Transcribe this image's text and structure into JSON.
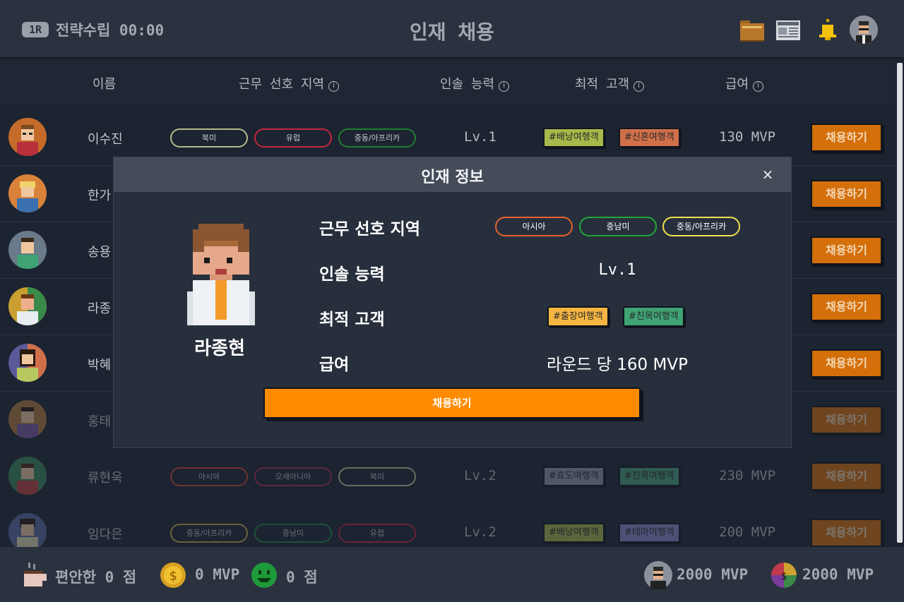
{
  "header": {
    "round_badge": "1R",
    "phase": "전략수립 00:00",
    "title": "인재 채용",
    "icons": [
      "folder-icon",
      "news-icon",
      "bell-icon",
      "user-avatar"
    ]
  },
  "table": {
    "columns": [
      "이름",
      "근무 선호 지역",
      "인솔 능력",
      "최적 고객",
      "급여"
    ],
    "hire_label": "채용하기",
    "rows": [
      {
        "name": "이수진",
        "regions": [
          {
            "label": "북미",
            "color": "#b5b98a"
          },
          {
            "label": "유럽",
            "color": "#c2283c"
          },
          {
            "label": "중동/아프리카",
            "color": "#1e7d33"
          }
        ],
        "level": "Lv.1",
        "customers": [
          {
            "label": "#배낭여행객",
            "color": "#a8b84a"
          },
          {
            "label": "#신혼여행객",
            "color": "#d0704a"
          }
        ],
        "salary": "130 MVP"
      },
      {
        "name": "한가",
        "regions": [],
        "level": "",
        "customers": [],
        "salary": ""
      },
      {
        "name": "송용",
        "regions": [],
        "level": "",
        "customers": [],
        "salary": ""
      },
      {
        "name": "라종",
        "regions": [],
        "level": "",
        "customers": [],
        "salary": ""
      },
      {
        "name": "박혜",
        "regions": [],
        "level": "",
        "customers": [],
        "salary": ""
      },
      {
        "name": "홍태",
        "regions": [],
        "level": "",
        "customers": [],
        "salary": ""
      },
      {
        "name": "류현욱",
        "regions": [
          {
            "label": "아시아",
            "color": "#d0463a"
          },
          {
            "label": "오세아니아",
            "color": "#b02a5a"
          },
          {
            "label": "북미",
            "color": "#c8c89a"
          }
        ],
        "level": "Lv.2",
        "customers": [
          {
            "label": "#효도여행객",
            "color": "#8a96a8"
          },
          {
            "label": "#친목여행객",
            "color": "#4aa07a"
          }
        ],
        "salary": "230 MVP"
      },
      {
        "name": "임다은",
        "regions": [
          {
            "label": "중동/아프리카",
            "color": "#c8b04a"
          },
          {
            "label": "중남미",
            "color": "#1e8a40"
          },
          {
            "label": "유럽",
            "color": "#c2283c"
          }
        ],
        "level": "Lv.2",
        "customers": [
          {
            "label": "#배낭여행객",
            "color": "#a8b84a"
          },
          {
            "label": "#테마여행객",
            "color": "#8a8ac8"
          }
        ],
        "salary": "200 MVP"
      }
    ]
  },
  "footer": {
    "comfort": "편안한 0 점",
    "coins": "0 MVP",
    "smile": "0 점",
    "player_money": "2000 MVP",
    "total_money": "2000 MVP"
  },
  "modal": {
    "title": "인재 정보",
    "close": "×",
    "candidate_name": "라종현",
    "label_region": "근무 선호 지역",
    "label_leadership": "인솔 능력",
    "label_customer": "최적 고객",
    "label_salary": "급여",
    "regions": [
      {
        "label": "아시아",
        "color": "#e5622c"
      },
      {
        "label": "중남미",
        "color": "#22a63a"
      },
      {
        "label": "중동/아프리카",
        "color": "#f0e050"
      }
    ],
    "level": "Lv.1",
    "customers": [
      {
        "label": "#출장여행객",
        "color": "#f5b642"
      },
      {
        "label": "#친목여행객",
        "color": "#3fa373"
      }
    ],
    "salary": "라운드 당 160 MVP",
    "hire_button": "채용하기"
  }
}
